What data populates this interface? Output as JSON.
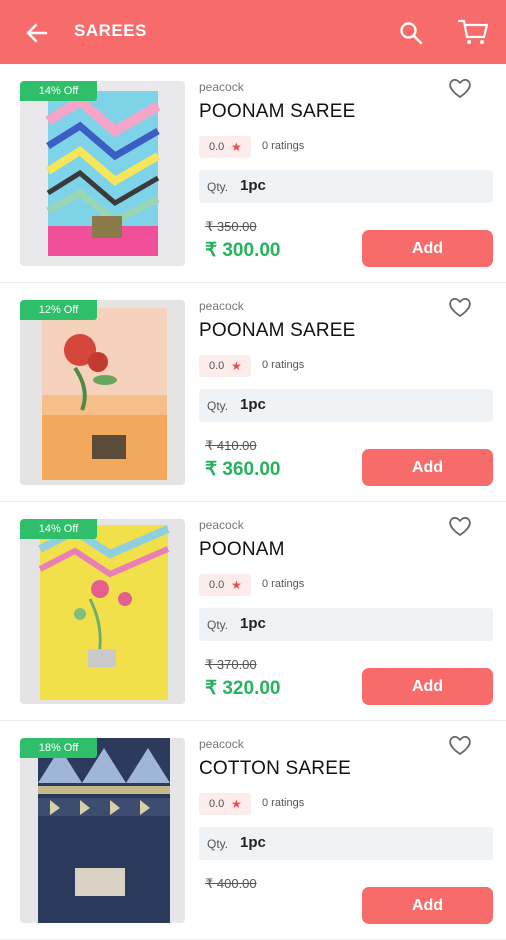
{
  "header": {
    "title": "SAREES",
    "back_icon": "arrow-left-icon",
    "search_icon": "search-icon",
    "cart_icon": "cart-icon",
    "bg_color": "#f76b6b"
  },
  "colors": {
    "accent": "#f76b6b",
    "discount_badge": "#2fbf6b",
    "price": "#27b25e",
    "star": "#f04b4b"
  },
  "products": [
    {
      "discount": "14% Off",
      "brand": "peacock",
      "name": "POONAM SAREE",
      "rating": "0.0",
      "ratings_text": "0 ratings",
      "qty_label": "Qty.",
      "qty_value": "1pc",
      "mrp": "₹ 350.00",
      "price": "₹ 300.00",
      "add_label": "Add"
    },
    {
      "discount": "12% Off",
      "brand": "peacock",
      "name": "POONAM SAREE",
      "rating": "0.0",
      "ratings_text": "0 ratings",
      "qty_label": "Qty.",
      "qty_value": "1pc",
      "mrp": "₹ 410.00",
      "price": "₹ 360.00",
      "add_label": "Add"
    },
    {
      "discount": "14% Off",
      "brand": "peacock",
      "name": "POONAM",
      "rating": "0.0",
      "ratings_text": "0 ratings",
      "qty_label": "Qty.",
      "qty_value": "1pc",
      "mrp": "₹ 370.00",
      "price": "₹ 320.00",
      "add_label": "Add"
    },
    {
      "discount": "18% Off",
      "brand": "peacock",
      "name": "COTTON SAREE",
      "rating": "0.0",
      "ratings_text": "0 ratings",
      "qty_label": "Qty.",
      "qty_value": "1pc",
      "mrp": "₹ 400.00",
      "price": "",
      "add_label": "Add"
    }
  ]
}
